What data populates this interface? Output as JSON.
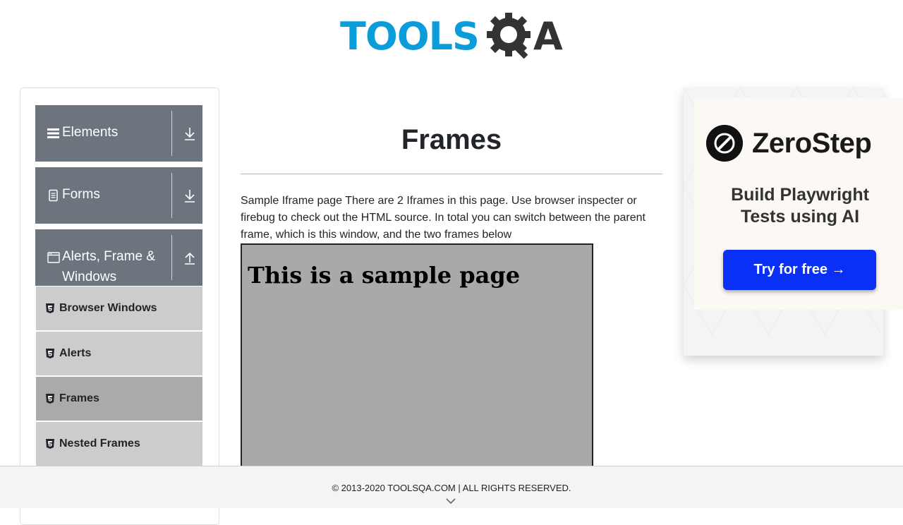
{
  "header": {
    "logo_text": "TOOLS",
    "logo_suffix": "A"
  },
  "sidebar": {
    "groups": [
      {
        "label": "Elements",
        "icon": "hamburger-icon",
        "arrow": "download-icon"
      },
      {
        "label": "Forms",
        "icon": "document-icon",
        "arrow": "download-icon"
      },
      {
        "label_line1": "Alerts, Frame &",
        "label_line2": "Windows",
        "icon": "window-icon",
        "arrow": "upload-icon"
      }
    ],
    "sub_items": [
      {
        "label": "Browser Windows",
        "icon": "html5-icon"
      },
      {
        "label": "Alerts",
        "icon": "html5-icon"
      },
      {
        "label": "Frames",
        "icon": "html5-icon",
        "active": true
      },
      {
        "label": "Nested Frames",
        "icon": "html5-icon"
      }
    ]
  },
  "main": {
    "title": "Frames",
    "description": "Sample Iframe page There are 2 Iframes in this page. Use browser inspecter or firebug to check out the HTML source. In total you can switch between the parent frame, which is this window, and the two frames below",
    "frame_heading": "This is a sample page"
  },
  "ad": {
    "brand": "ZeroStep",
    "subtitle": "Build Playwright Tests using AI",
    "button": "Try for free →"
  },
  "footer": {
    "text": "© 2013-2020 TOOLSQA.COM | ALL RIGHTS RESERVED."
  },
  "colors": {
    "accent": "#0b9dd9",
    "sidebar_group": "#6c757d",
    "sub_item": "#cccccc",
    "sub_item_active": "#aaaaaa",
    "ad_button": "#0a30f5"
  }
}
